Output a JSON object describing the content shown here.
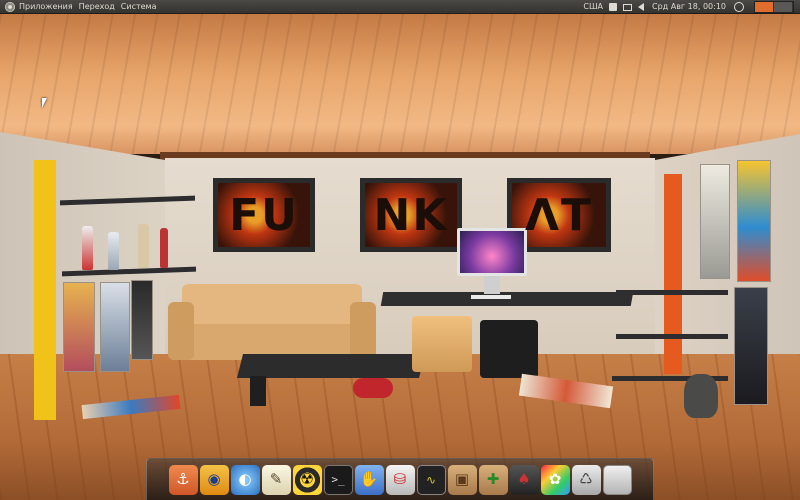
{
  "top_panel": {
    "menus": [
      "Приложения",
      "Переход",
      "Система"
    ],
    "keyboard_layout": "США",
    "clock": "Срд Авг 18, 00:10",
    "workspaces": {
      "count": 2,
      "active": 1
    }
  },
  "dock": {
    "items": [
      {
        "name": "anchor-app-icon",
        "glyph": "⚓"
      },
      {
        "name": "eye-app-icon",
        "glyph": "◉"
      },
      {
        "name": "earth-app-icon",
        "glyph": "◐"
      },
      {
        "name": "notes-app-icon",
        "glyph": "✎"
      },
      {
        "name": "radiation-app-icon",
        "glyph": "☢"
      },
      {
        "name": "terminal-app-icon",
        "glyph": ">_"
      },
      {
        "name": "fingers-app-icon",
        "glyph": "✋"
      },
      {
        "name": "disk-utility-app-icon",
        "glyph": "⛁"
      },
      {
        "name": "system-monitor-app-icon",
        "glyph": "∿"
      },
      {
        "name": "archive-app-icon",
        "glyph": "▣"
      },
      {
        "name": "package-installer-app-icon",
        "glyph": "✚"
      },
      {
        "name": "suit-app-icon",
        "glyph": "♠"
      },
      {
        "name": "paint-app-icon",
        "glyph": "✿"
      },
      {
        "name": "trash-icon",
        "glyph": "♺"
      },
      {
        "name": "drive-icon",
        "glyph": ""
      }
    ]
  },
  "wallpaper": {
    "poster_letters": [
      "FU",
      "NK",
      "ΛT"
    ]
  },
  "colors": {
    "panel_bg": "#3d3c38",
    "active_workspace": "#e06d2c"
  }
}
